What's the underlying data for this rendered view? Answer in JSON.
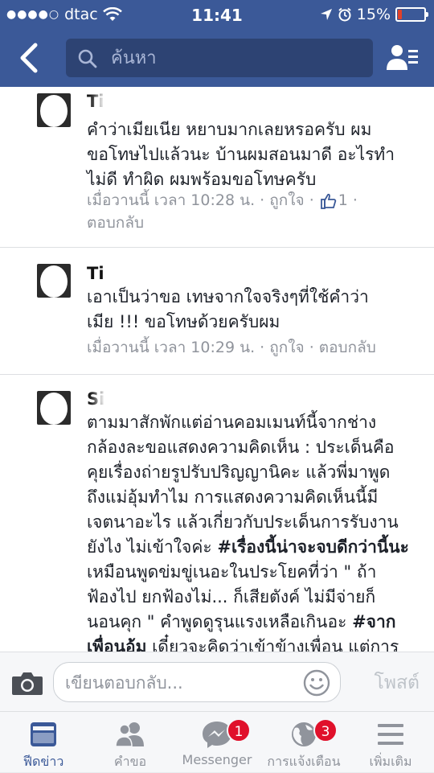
{
  "status_bar": {
    "carrier": "dtac",
    "time": "11:41",
    "battery": "15%",
    "battery_level": 0.15
  },
  "nav": {
    "search_placeholder": "ค้นหา"
  },
  "comments": [
    {
      "name": "Ti",
      "lines": [
        "คำว่าเมียเนีย หยาบมากเลยหรอครับ ผม",
        "ขอโทษไปแล้วนะ บ้านผมสอนมาดี อะไรทำ",
        "ไม่ดี ทำผิด ผมพร้อมขอโทษครับ"
      ],
      "meta1": "เมื่อวานนี้ เวลา 10:28 น. · ถูกใจ · ",
      "likes": "1",
      "meta1_end": " ·",
      "meta2": "ตอบกลับ"
    },
    {
      "name": "Ti",
      "lines": [
        "เอาเป็นว่าขอ เทษจากใจจริงๆที่ใช้คำว่า",
        "เมีย !!! ขอโทษด้วยครับผม"
      ],
      "meta1": "เมื่อวานนี้ เวลา 10:29 น. · ถูกใจ · ตอบกลับ"
    },
    {
      "name": "Si",
      "lines": [
        "ตามมาสักพักแต่อ่านคอมเมนท์นี้จากช่าง",
        "กล้องละขอแสดงความคิดเห็น : ประเด็นคือ",
        "คุยเรื่องถ่ายรูปรับปริญญานิคะ แล้วพี่มาพูด",
        "ถึงแม่อุ้มทำไม การแสดงความคิดเห็นนี้มี",
        "เจตนาอะไร แล้วเกี่ยวกับประเด็นการรับงาน",
        "ยังไง ไม่เข้าใจค่ะ ",
        "เหมือนพูดข่มขู่เนอะในประโยคที่ว่า \" ถ้า",
        "ฟ้องไป ยกฟ้องไม่... ก็เสียตังค์ ไม่มีจ่ายก็",
        "นอนคุก \" คำพูดดูรุนแรงเหลือเกินอะ  ",
        "",
        " เดี๋ยวจะคิดว่าเข้าข้างเพื่อน แต่การ"
      ],
      "hashtag1": "#เรื่องนี้น่าจะจบดีกว่านี้นะ",
      "hashtag2": "#จาก",
      "hashtag3": "เพื่อนอุ้ม"
    }
  ],
  "composer": {
    "placeholder": "เขียนตอบกลับ...",
    "post_label": "โพสต์"
  },
  "tabs": [
    {
      "label": "ฟีดข่าว",
      "icon": "news-feed-icon",
      "active": true
    },
    {
      "label": "คำขอ",
      "icon": "friend-requests-icon"
    },
    {
      "label": "Messenger",
      "icon": "messenger-icon",
      "badge": "1"
    },
    {
      "label": "การแจ้งเตือน",
      "icon": "globe-notifications-icon",
      "badge": "3"
    },
    {
      "label": "เพิ่มเติม",
      "icon": "menu-icon"
    }
  ],
  "colors": {
    "brand": "#3b5998",
    "badge": "#e0112b",
    "meta_text": "#90949c"
  }
}
